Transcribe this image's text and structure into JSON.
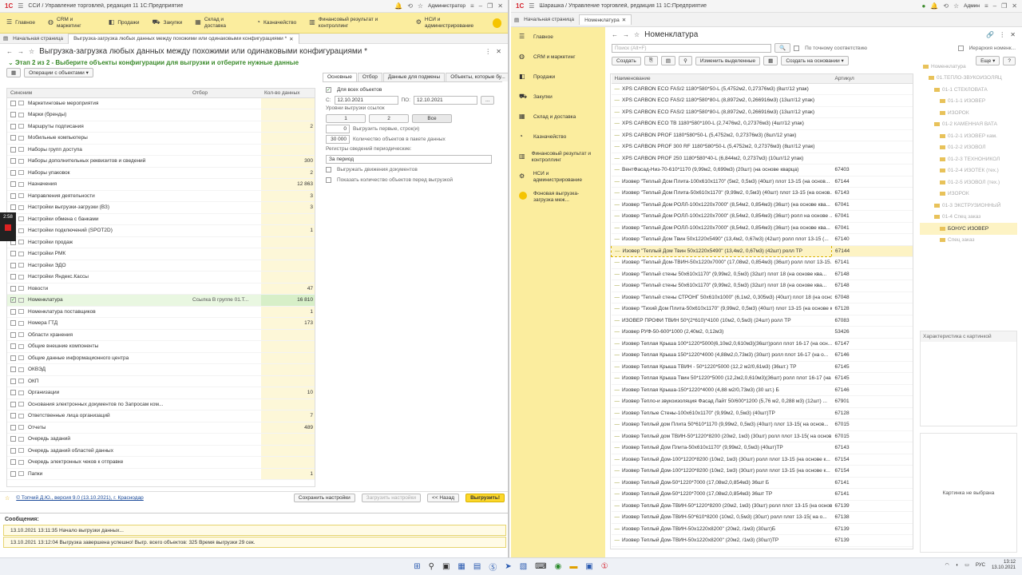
{
  "left": {
    "title": "ССИ / Управление торговлей, редакция 11 1С:Предприятие",
    "user": "Администратор",
    "sections": [
      {
        "icon": "menu-icon",
        "label": "Главное"
      },
      {
        "icon": "crm-icon",
        "label": "CRM и маркетинг"
      },
      {
        "icon": "sales-icon",
        "label": "Продажи"
      },
      {
        "icon": "purchases-icon",
        "label": "Закупки"
      },
      {
        "icon": "warehouse-icon",
        "label": "Склад и доставка"
      },
      {
        "icon": "treasury-icon",
        "label": "Казначейство"
      },
      {
        "icon": "finance-icon",
        "label": "Финансовый результат и контроллинг"
      },
      {
        "icon": "nsi-icon",
        "label": "НСИ и администрирование"
      }
    ],
    "tabs": [
      "Начальная страница",
      "Выгрузка-загрузка любых данных между похожими или одинаковыми конфигурациями *"
    ],
    "form_title": "Выгрузка-загрузка любых данных между похожими или одинаковыми конфигурациями *",
    "stage": "Этап 2 из 2 - Выберите объекты конфигурации для выгрузки и отберите нужные данные",
    "ops_button": "Операции с объектами",
    "table_headers": [
      "Синоним",
      "Отбор",
      "Кол-во данных"
    ],
    "rows": [
      {
        "name": "Маркетинговые мероприятия",
        "filter": "",
        "count": "",
        "checked": false
      },
      {
        "name": "Марки (бренды)",
        "filter": "",
        "count": "",
        "checked": false
      },
      {
        "name": "Маршруты подписания",
        "filter": "",
        "count": "2",
        "checked": false
      },
      {
        "name": "Мобильные компьютеры",
        "filter": "",
        "count": "",
        "checked": false
      },
      {
        "name": "Наборы групп доступа",
        "filter": "",
        "count": "",
        "checked": false
      },
      {
        "name": "Наборы дополнительных реквизитов и сведений",
        "filter": "",
        "count": "300",
        "checked": false
      },
      {
        "name": "Наборы упаковок",
        "filter": "",
        "count": "2",
        "checked": false
      },
      {
        "name": "Назначения",
        "filter": "",
        "count": "12 863",
        "checked": false
      },
      {
        "name": "Направления деятельности",
        "filter": "",
        "count": "3",
        "checked": false
      },
      {
        "name": "Настройки выгрузки-загрузки (ВЗ)",
        "filter": "",
        "count": "3",
        "checked": false
      },
      {
        "name": "Настройки обмена с банками",
        "filter": "",
        "count": "",
        "checked": false
      },
      {
        "name": "Настройки подключений (SPOT2D)",
        "filter": "",
        "count": "1",
        "checked": false
      },
      {
        "name": "Настройки продаж",
        "filter": "",
        "count": "",
        "checked": false
      },
      {
        "name": "Настройки РМК",
        "filter": "",
        "count": "",
        "checked": false
      },
      {
        "name": "Настройки ЭДО",
        "filter": "",
        "count": "",
        "checked": false
      },
      {
        "name": "Настройки Яндекс.Кассы",
        "filter": "",
        "count": "",
        "checked": false
      },
      {
        "name": "Новости",
        "filter": "",
        "count": "47",
        "checked": false
      },
      {
        "name": "Номенклатура",
        "filter": "Ссылка В группе 01.Т...",
        "count": "16 810",
        "checked": true
      },
      {
        "name": "Номенклатура поставщиков",
        "filter": "",
        "count": "1",
        "checked": false
      },
      {
        "name": "Номера ГТД",
        "filter": "",
        "count": "173",
        "checked": false
      },
      {
        "name": "Области хранения",
        "filter": "",
        "count": "",
        "checked": false
      },
      {
        "name": "Общие внешние компоненты",
        "filter": "",
        "count": "",
        "checked": false
      },
      {
        "name": "Общие данные информационного центра",
        "filter": "",
        "count": "",
        "checked": false
      },
      {
        "name": "ОКВЭД",
        "filter": "",
        "count": "",
        "checked": false
      },
      {
        "name": "ОКП",
        "filter": "",
        "count": "",
        "checked": false
      },
      {
        "name": "Организации",
        "filter": "",
        "count": "10",
        "checked": false
      },
      {
        "name": "Основания электронных документов по Запросам ком...",
        "filter": "",
        "count": "",
        "checked": false
      },
      {
        "name": "Ответственные лица организаций",
        "filter": "",
        "count": "7",
        "checked": false
      },
      {
        "name": "Отчеты",
        "filter": "",
        "count": "489",
        "checked": false
      },
      {
        "name": "Очередь заданий",
        "filter": "",
        "count": "",
        "checked": false
      },
      {
        "name": "Очередь заданий областей данных",
        "filter": "",
        "count": "",
        "checked": false
      },
      {
        "name": "Очередь электронных чеков к отправке",
        "filter": "",
        "count": "",
        "checked": false
      },
      {
        "name": "Папки",
        "filter": "",
        "count": "1",
        "checked": false
      }
    ],
    "right_tabs": [
      "Основные",
      "Отбор",
      "Данные для подмены",
      "Объекты, которые бу..."
    ],
    "all_objects": "Для всех объектов",
    "date_from_label": "С:",
    "date_from": "12.10.2021",
    "date_to_label": "ПО:",
    "date_to": "12.10.2021",
    "levels_label": "Уровни выгрузки ссылок",
    "levels": [
      "1",
      "2",
      "Все"
    ],
    "first_n": "0",
    "first_n_label": "Выгрузить первые, строк(и)",
    "batch": "30 000",
    "batch_label": "Количество объектов в пакете данных",
    "registers_label": "Регистры сведений периодические:",
    "registers_value": "За период",
    "opt_movements": "Выгружать движения документов",
    "opt_show_count": "Показать количество объектов перед выгрузкой",
    "footer_link": "© Топчий Д.Ю., версия 9.0 (13.10.2021), г. Краснодар",
    "btn_save": "Сохранить настройки",
    "btn_load": "Загрузить настройки",
    "btn_back": "<< Назад",
    "btn_export": "Выгрузить!",
    "messages_title": "Сообщения:",
    "messages": [
      "13.10.2021 13:11:35 Начало выгрузки данных...",
      "13.10.2021 13:12:04 Выгрузка завершена успешно! Выгр. всего объектов: 325 Время выгрузки 29 сек."
    ],
    "timer": "2:58"
  },
  "right": {
    "title": "Шарашка / Управление торговлей, редакция 11 1С:Предприятие",
    "user": "Админ",
    "tabs": [
      "Начальная страница",
      "Номенклатура"
    ],
    "sidebar": [
      {
        "icon": "menu-icon",
        "label": "Главное"
      },
      {
        "icon": "crm-icon",
        "label": "CRM и маркетинг"
      },
      {
        "icon": "sales-icon",
        "label": "Продажи"
      },
      {
        "icon": "purchases-icon",
        "label": "Закупки"
      },
      {
        "icon": "warehouse-icon",
        "label": "Склад и доставка"
      },
      {
        "icon": "treasury-icon",
        "label": "Казначейство"
      },
      {
        "icon": "finance-icon",
        "label": "Финансовый результат и контроллинг"
      },
      {
        "icon": "nsi-icon",
        "label": "НСИ и администрирование"
      },
      {
        "icon": "bg-task-icon",
        "label": "Фоновая выгрузка-загрузка меж..."
      }
    ],
    "form_title": "Номенклатура",
    "search_placeholder": "Поиск (Alt+F)",
    "exact_match": "По точному соответствию",
    "hierarchy": "Иерархия номенк...",
    "btn_create": "Создать",
    "btn_change": "Изменить выделенные",
    "btn_create_basis": "Создать на основании",
    "btn_more": "Еще",
    "headers": [
      "Наименование",
      "Артикул"
    ],
    "rows": [
      {
        "name": "XPS CARBON ECO FAS/2  1180*580*50-L (5,4752м2, 0,27376м3) (8шт/12 упак)",
        "art": ""
      },
      {
        "name": "XPS CARBON ECO FAS/2  1180*580*80-L (8,8972м2, 0,266916м3) (13шт/12 упак)",
        "art": ""
      },
      {
        "name": "XPS CARBON ECO FAS/2  1180*580*80-L (8,8972м2, 0,266916м3) (13шт/12 упак)",
        "art": ""
      },
      {
        "name": "XPS CARBON ECO TB  1180*580*100-L (2,7476м2, 0,27376м3) (4шт/12 упак)",
        "art": ""
      },
      {
        "name": "XPS CARBON PROF  1180*580*50-L (5,4752м2, 0,27376м3) (8шт/12 упак)",
        "art": ""
      },
      {
        "name": "XPS CARBON PROF  300 RF 1180*580*50-L (5,4752м2, 0,27376м3) (8шт/12 упак)",
        "art": ""
      },
      {
        "name": "XPS CARBON PROF 250  1180*580*40-L (6,844м2, 0,2737м3) (10шт/12 упак)",
        "art": ""
      },
      {
        "name": "ВентФасад-Низ-70-610*1170 (9,99м2, 0,699м3) (20шт) (на основе кварца)",
        "art": "67403"
      },
      {
        "name": "Изовер \"Теплый Дом Плита-100х610х1170\" (5м2, 0,5м3) (40шт) плот 13-15 (на основ...",
        "art": "67144"
      },
      {
        "name": "Изовер \"Теплый Дом Плита-50х610х1170\" (9,99м2, 0,5м3) (40шт) плот 13-15 (на основ...",
        "art": "67143"
      },
      {
        "name": "Изовер \"Теплый Дом РОЛЛ-100х1220х7000\" (8,54м2, 0,854м3) (36шт) (на основе ква...",
        "art": "67041"
      },
      {
        "name": "Изовер \"Теплый Дом РОЛЛ-100х1220х7000\" (8,54м2, 0,854м3) (36шт) ролл на основе ...",
        "art": "67041"
      },
      {
        "name": "Изовер \"Теплый Дом РОЛЛ-100х1220х7000\" (8,54м2, 0,854м3) (36шт) (на основе ква...",
        "art": "67041"
      },
      {
        "name": "Изовер \"Теплый Дом Твин 50х1220х5490\" (13,4м2, 0,67м3) (42шт) ролл плот 13-15 (...",
        "art": "67140"
      },
      {
        "name": "Изовер \"Теплый Дом Твин 50х1220х5490\" (13,4м2, 0,67м3) (42шт) ролл ТР",
        "art": "67144",
        "selected": true
      },
      {
        "name": "Изовер \"Теплый Дом-ТВИН-50х1220х7000\" (17,08м2, 0,854м3) (36шт) ролл плот 13-15...",
        "art": "67141"
      },
      {
        "name": "Изовер \"Теплый стены 50х610х1170\" (9,99м2, 0,5м3) (32шт) плот 18 (на основе ква...",
        "art": "67148"
      },
      {
        "name": "Изовер \"Теплый стены 50х610х1170\" (9,99м2, 0,5м3) (32шт) плот 18 (на основе ква...",
        "art": "67148"
      },
      {
        "name": "Изовер \"Теплый стены СТРОНГ 50х610х1000\" (6,1м2, 0,305м3) (40шт) плот 18 (на осно...",
        "art": "67048"
      },
      {
        "name": "Изовер \"Тихий Дом Плита-50х610х1170\" (9,99м2, 0,5м3) (40шт) плот 13-15 (на основе к...",
        "art": "67128"
      },
      {
        "name": "ИЗОВЕР ПРОФИ ТВИН 50*(2*610)*4100 (10м2, 0,5м3) (24шт) ролл ТР",
        "art": "67083"
      },
      {
        "name": "Изовер РУФ-50-600*1000 (2,40м2, 0,12м3)",
        "art": "53426"
      },
      {
        "name": "Изовер Теплая Крыша 100*1220*5000(6,10м2,0,610м3)(36шт)ролл плот 16-17 (на осн...",
        "art": "67147"
      },
      {
        "name": "Изовер Теплая Крыша 150*1220*4000 (4,88м2,0,73м3) (30шт) ролл плот 16-17 (на о...",
        "art": "67146"
      },
      {
        "name": "Изовер Теплая Крыша ТВИН - 50*1220*5000 (12,2 м2/0,61м3) (36шт.) ТР",
        "art": "67145"
      },
      {
        "name": "Изовер Теплая Крыша Твин 50*1220*5000 (12,2м2,0,610м3)(36шт) ролл плот 16-17 (на ...",
        "art": "67145"
      },
      {
        "name": "Изовер Теплая Крыша-150*1220*4000 (4,88 м2/0,73м3) (30 шт.) Б",
        "art": "67146"
      },
      {
        "name": "Изовер Тепло-и звукоизоляция Фасад Лайт 50/600*1200 (5,76 м2, 0,288 м3) (12шт) ...",
        "art": "67901"
      },
      {
        "name": "Изовер Теплые Стены-100х610х1170\" (9,99м2, 0,5м3) (40шт)ТР",
        "art": "67128"
      },
      {
        "name": "Изовер Теплый дом  Плита 50*610*1170 (9,99м2, 0,5м3) (40шт)  плот 13-15( на основ...",
        "art": "67015"
      },
      {
        "name": "Изовер Теплый дом  ТВИН-50*1220*8200 (20м2, 1м3) (30шт) ролл плот 13-15( на основ...",
        "art": "67015"
      },
      {
        "name": "Изовер Теплый Дом Плита-50х610х1170\" (9,99м2, 0,5м3) (40шт)ТР",
        "art": "67143"
      },
      {
        "name": "Изовер Теплый Дом-100*1220*8200 (10м2, 1м3) (30шт) ролл плот 13-15 (на основе к...",
        "art": "67154"
      },
      {
        "name": "Изовер Теплый Дом-100*1220*8200 (10м2, 1м3) (30шт) ролл плот 13-15 (на основе к...",
        "art": "67154"
      },
      {
        "name": "Изовер Теплый Дом-50*1220*7000 (17,08м2,0,854м3) 36шт Б",
        "art": "67141"
      },
      {
        "name": "Изовер Теплый Дом-50*1220*7000 (17,08м2,0,854м3) 36шт ТР",
        "art": "67141"
      },
      {
        "name": "Изовер Теплый Дом-ТВИН-50*1220*8200 (20м2, 1м3) (30шт) ролл плот 13-15 (на основ...",
        "art": "67139"
      },
      {
        "name": "Изовер Теплый Дом-ТВИН-50*610*8200 (10м2, 0,5м3) (30шт) ролл плот 13-15( на о...",
        "art": "67138"
      },
      {
        "name": "Изовер Теплый Дом-ТВИН-50х1220х8200\" (20м2, /1м3) (30шт)Б",
        "art": "67139"
      },
      {
        "name": "Изовер Теплый Дом-ТВИН-50х1220х8200\" (20м2, /1м3) (30шт)ТР",
        "art": "67139"
      }
    ],
    "tree": [
      "Номенклатура",
      "01.ТЕПЛО-ЗВУКОИЗОЛЯЦ",
      "01-1 СТЕКЛОВАТА",
      "01-1-1 ИЗОВЕР",
      "ИЗОРОК",
      "01-2 КАМЕННАЯ ВАТА",
      "01-2-1 ИЗОВЕР кам.",
      "01-2-2 ИЗОВОЛ",
      "01-2-3 ТЕХНОНИКОЛ",
      "01-2-4 ИЗОТЕК (тех.)",
      "01-2-5 ИЗОВОЛ (тех.)",
      "ИЗОРОК",
      "01-3 ЭКСТРУЗИОННЫЙ",
      "01-4 Спец заказ",
      "БОНУС ИЗОВЕР",
      "Спец заказ"
    ],
    "characteristics": "Характеристика с картинкой",
    "no_picture": "Картинка не выбрана"
  },
  "taskbar": {
    "lang": "РУС",
    "time": "13:12",
    "date": "13.10.2021"
  }
}
